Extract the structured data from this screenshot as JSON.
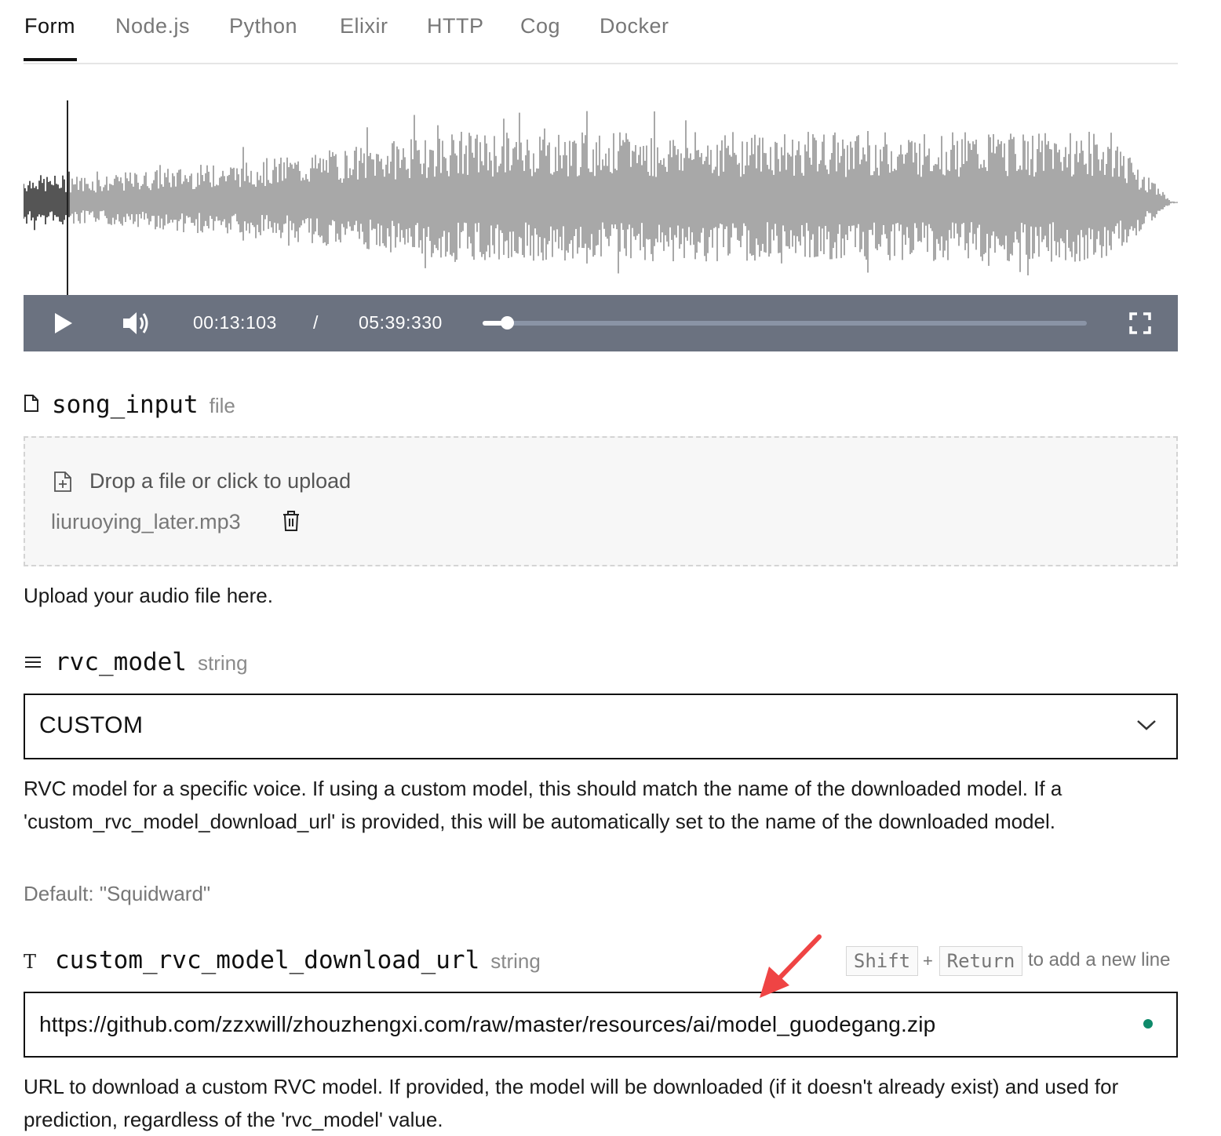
{
  "tabs": {
    "items": [
      {
        "label": "Form",
        "active": true
      },
      {
        "label": "Node.js"
      },
      {
        "label": "Python"
      },
      {
        "label": "Elixir"
      },
      {
        "label": "HTTP"
      },
      {
        "label": "Cog"
      },
      {
        "label": "Docker"
      }
    ]
  },
  "player": {
    "current_time": "00:13:103",
    "separator": "/",
    "duration": "05:39:330",
    "progress": 0.04,
    "colors": {
      "bar": "#6b7280",
      "waveform_played": "#555555",
      "waveform_rest": "#a8a8a8"
    },
    "icons": [
      "play-icon",
      "volume-icon",
      "fullscreen-icon"
    ]
  },
  "song_input": {
    "icon": "file-icon",
    "name": "song_input",
    "type": "file",
    "drop_text": "Drop a file or click to upload",
    "file_name": "liuruoying_later.mp3",
    "description": "Upload your audio file here."
  },
  "rvc_model": {
    "icon": "list-icon",
    "name": "rvc_model",
    "type": "string",
    "value": "CUSTOM",
    "description": "RVC model for a specific voice. If using a custom model, this should match the name of the downloaded model. If a 'custom_rvc_model_download_url' is provided, this will be automatically set to the name of the downloaded model.",
    "default": "Default: \"Squidward\""
  },
  "custom_url": {
    "icon": "text-icon",
    "name": "custom_rvc_model_download_url",
    "type": "string",
    "hint_key1": "Shift",
    "hint_plus": "+",
    "hint_key2": "Return",
    "hint_text": "to add a new line",
    "value": "https://github.com/zzxwill/zhouzhengxi.com/raw/master/resources/ai/model_guodegang.zip",
    "status_color": "#0e8a6a",
    "description": "URL to download a custom RVC model. If provided, the model will be downloaded (if it doesn't already exist) and used for prediction, regardless of the 'rvc_model' value."
  },
  "annotation": {
    "color": "#ef4444"
  }
}
